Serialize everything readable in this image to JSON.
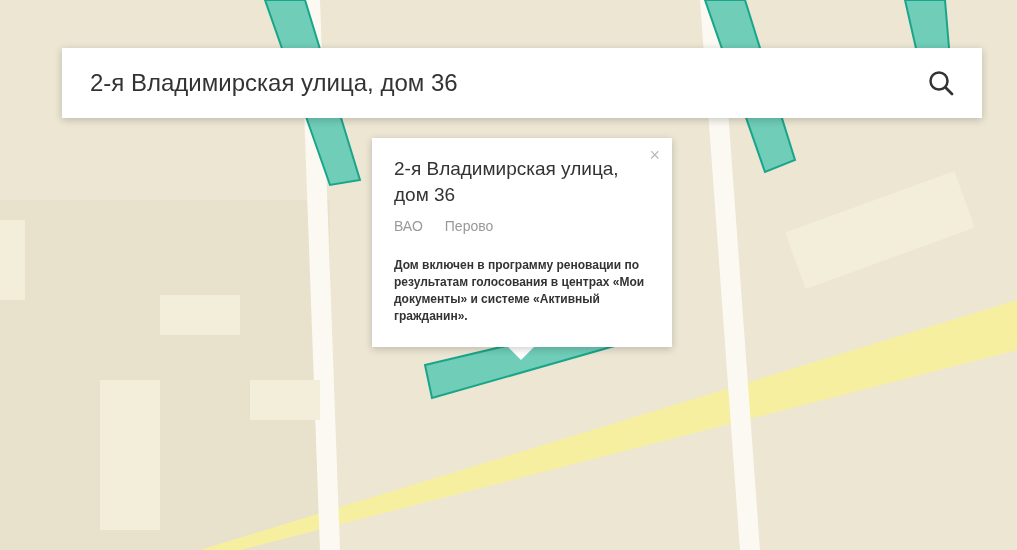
{
  "search": {
    "value": "2-я Владимирская улица, дом 36"
  },
  "popup": {
    "title": "2-я Владимирская улица, дом 36",
    "tags": [
      "ВАО",
      "Перово"
    ],
    "close": "×",
    "text": "Дом включен в программу реновации по результатам голосования в центрах «Мои документы» и системе «Активный гражданин»."
  }
}
